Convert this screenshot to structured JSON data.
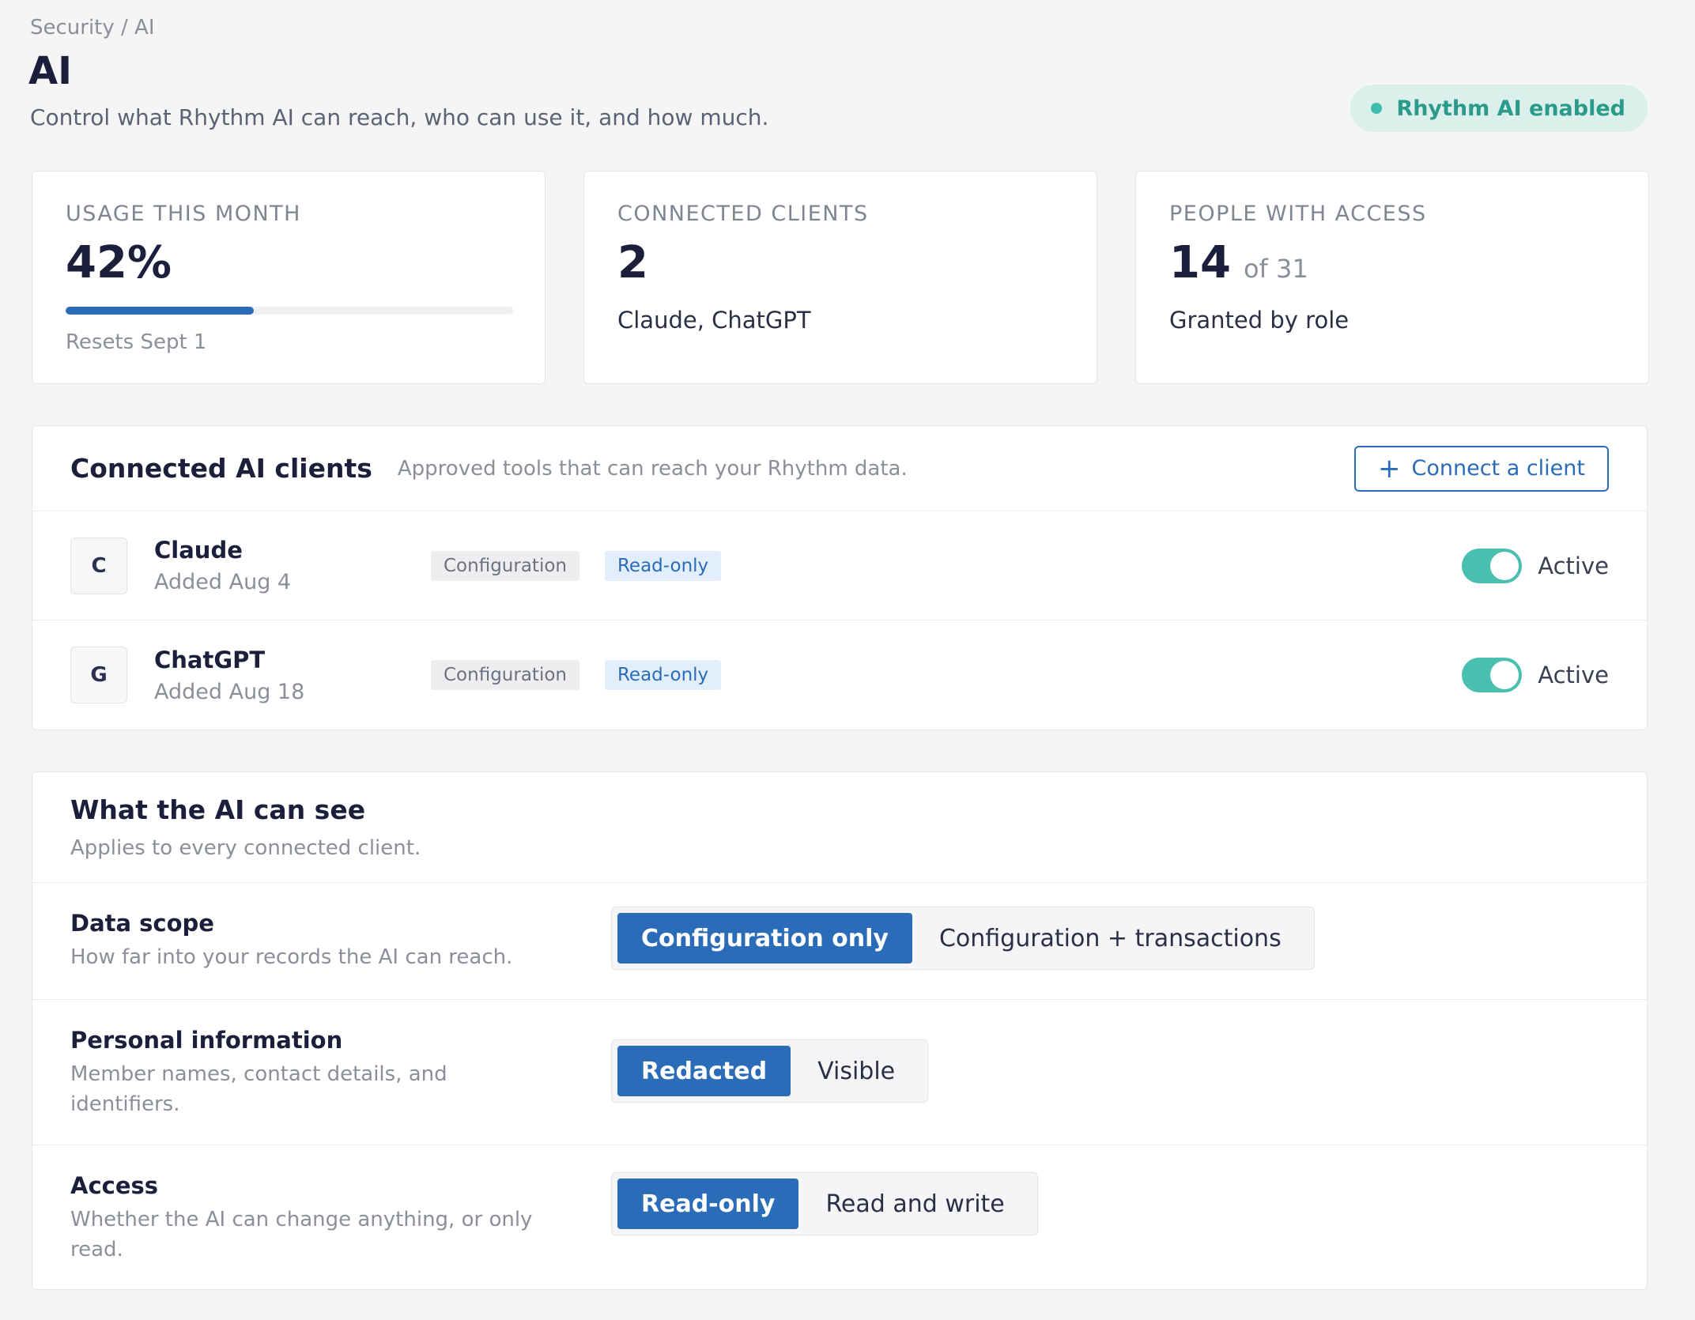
{
  "header": {
    "breadcrumb": "Security / AI",
    "title": "AI",
    "subtitle": "Control what Rhythm AI can reach, who can use it, and how much.",
    "status_badge": "Rhythm AI enabled"
  },
  "stats": {
    "usage": {
      "label": "USAGE THIS MONTH",
      "value": "42%",
      "progress": 0.42,
      "foot": "Resets Sept 1"
    },
    "clients": {
      "label": "CONNECTED CLIENTS",
      "value": "2",
      "foot": "Claude, ChatGPT"
    },
    "people": {
      "label": "PEOPLE WITH ACCESS",
      "value": "14",
      "value_sub": "of 31",
      "foot": "Granted by role"
    }
  },
  "clients_section": {
    "title": "Connected AI clients",
    "hint": "Approved tools that can reach your Rhythm data.",
    "connect_label": "Connect a client",
    "items": [
      {
        "initial": "C",
        "name": "Claude",
        "added": "Added Aug 4",
        "scope_tag": "Configuration",
        "access_tag": "Read-only",
        "status": "Active"
      },
      {
        "initial": "G",
        "name": "ChatGPT",
        "added": "Added Aug 18",
        "scope_tag": "Configuration",
        "access_tag": "Read-only",
        "status": "Active"
      }
    ]
  },
  "visibility_section": {
    "title": "What the AI can see",
    "subtitle": "Applies to every connected client.",
    "settings": [
      {
        "title": "Data scope",
        "desc": "How far into your records the AI can reach.",
        "options": [
          "Configuration only",
          "Configuration + transactions"
        ],
        "selected": "Configuration only"
      },
      {
        "title": "Personal information",
        "desc": "Member names, contact details, and identifiers.",
        "options": [
          "Redacted",
          "Visible"
        ],
        "selected": "Redacted"
      },
      {
        "title": "Access",
        "desc": "Whether the AI can change anything, or only read.",
        "options": [
          "Read-only",
          "Read and write"
        ],
        "selected": "Read-only"
      }
    ]
  },
  "colors": {
    "accent": "#2b6cb8",
    "success": "#49bfb0",
    "badge_bg": "#dbefeb"
  }
}
